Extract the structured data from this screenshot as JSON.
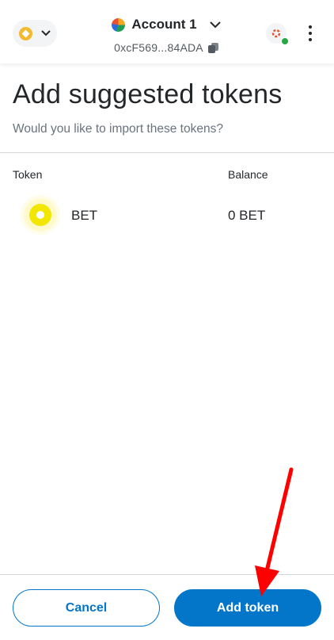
{
  "header": {
    "network_icon": "bnb-chain-icon",
    "account_name": "Account 1",
    "account_address": "0xcF569...84ADA",
    "connected_status_color": "#28a745"
  },
  "page": {
    "title": "Add suggested tokens",
    "subtitle": "Would you like to import these tokens?"
  },
  "table": {
    "columns": [
      "Token",
      "Balance"
    ],
    "rows": [
      {
        "symbol": "BET",
        "balance": "0 BET",
        "icon": "bet-token-icon"
      }
    ]
  },
  "actions": {
    "cancel_label": "Cancel",
    "add_label": "Add token"
  },
  "colors": {
    "primary": "#0376c9",
    "annotation_arrow": "#ff0000"
  }
}
